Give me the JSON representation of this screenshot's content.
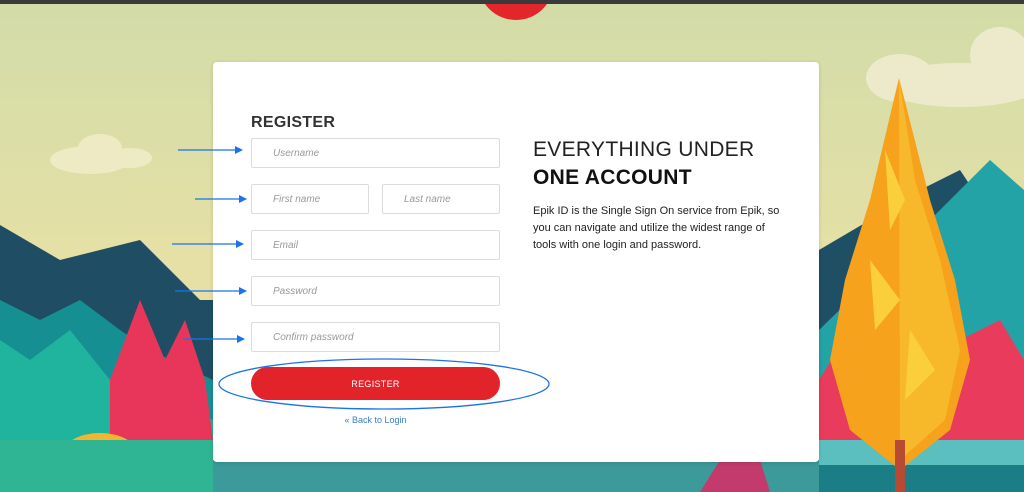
{
  "form": {
    "title": "REGISTER",
    "username_placeholder": "Username",
    "first_name_placeholder": "First name",
    "last_name_placeholder": "Last name",
    "email_placeholder": "Email",
    "password_placeholder": "Password",
    "confirm_password_placeholder": "Confirm password",
    "register_button": "REGISTER",
    "back_link": "« Back to Login"
  },
  "info": {
    "headline_line1": "EVERYTHING UNDER",
    "headline_line2": "ONE ACCOUNT",
    "description": "Epik ID is the Single Sign On service from Epik, so you can navigate and utilize the widest range of tools with one login and password."
  },
  "colors": {
    "accent": "#e2232a",
    "annotation": "#1a73e8",
    "link": "#3a7cc6"
  }
}
